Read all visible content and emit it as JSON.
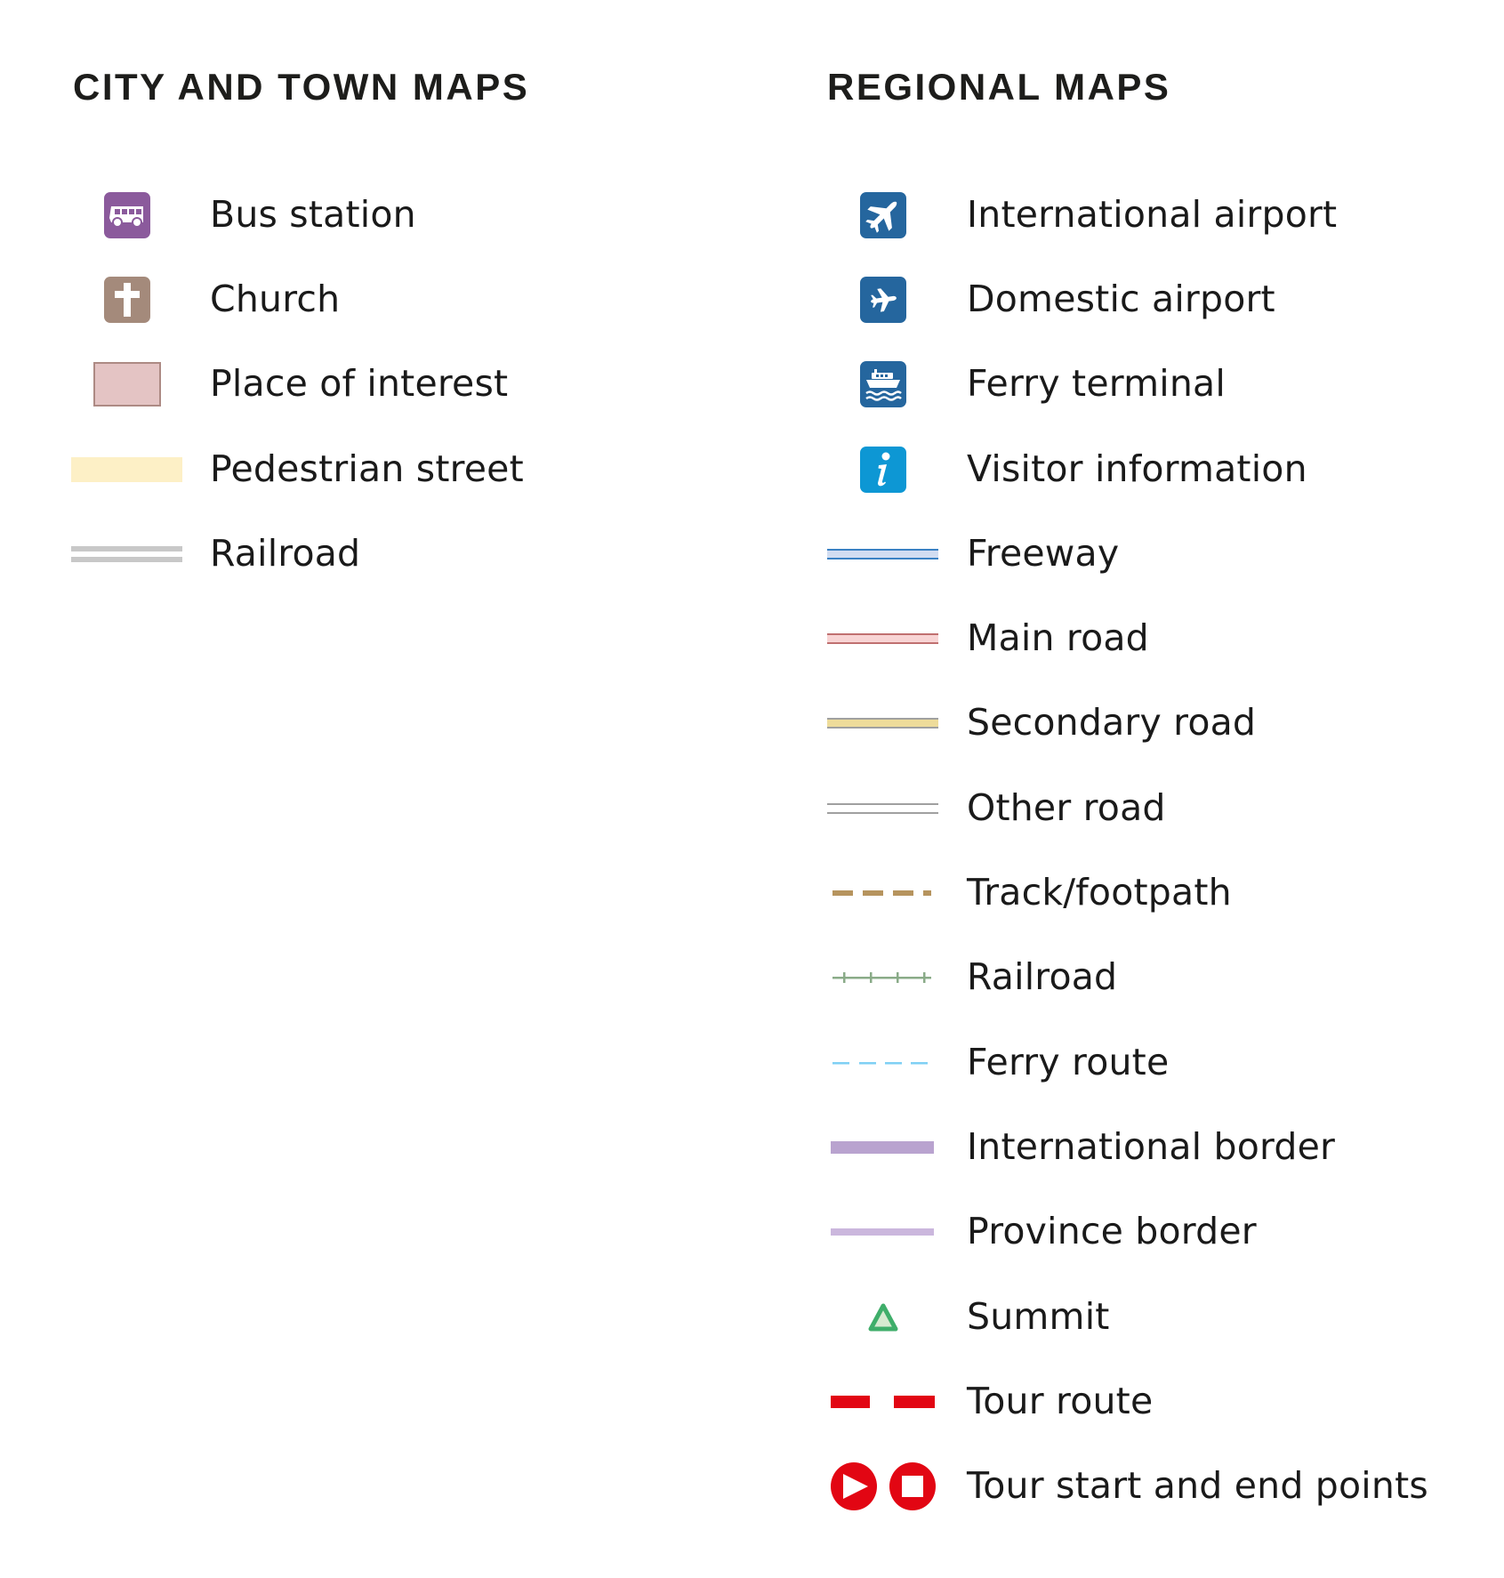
{
  "legend": {
    "city_and_town": {
      "title": "CITY AND TOWN MAPS",
      "items": [
        {
          "label": "Bus station",
          "symbol": "bus-icon",
          "color": "#8b5a9c"
        },
        {
          "label": "Church",
          "symbol": "church-icon",
          "color": "#a48a7b"
        },
        {
          "label": "Place of interest",
          "symbol": "place-of-interest-swatch",
          "color": "#e4c4c4"
        },
        {
          "label": "Pedestrian street",
          "symbol": "pedestrian-street-swatch",
          "color": "#fdf0c6"
        },
        {
          "label": "Railroad",
          "symbol": "railroad-double-line",
          "color": "#c8c8c8"
        }
      ]
    },
    "regional": {
      "title": "REGIONAL MAPS",
      "items": [
        {
          "label": "International airport",
          "symbol": "international-airport-icon",
          "color": "#25669e"
        },
        {
          "label": "Domestic airport",
          "symbol": "domestic-airport-icon",
          "color": "#25669e"
        },
        {
          "label": "Ferry terminal",
          "symbol": "ferry-terminal-icon",
          "color": "#25669e"
        },
        {
          "label": "Visitor information",
          "symbol": "visitor-information-icon",
          "color": "#0d97d4"
        },
        {
          "label": "Freeway",
          "symbol": "freeway-line",
          "color": "#3b82c4"
        },
        {
          "label": "Main road",
          "symbol": "main-road-line",
          "color": "#c07070"
        },
        {
          "label": "Secondary road",
          "symbol": "secondary-road-line",
          "color": "#eedc9a"
        },
        {
          "label": "Other road",
          "symbol": "other-road-line",
          "color": "#a0a0a0"
        },
        {
          "label": "Track/footpath",
          "symbol": "track-footpath-dashed-line",
          "color": "#b6945e"
        },
        {
          "label": "Railroad",
          "symbol": "railroad-ticked-line",
          "color": "#8aab88"
        },
        {
          "label": "Ferry route",
          "symbol": "ferry-route-dashed-line",
          "color": "#7fd0f4"
        },
        {
          "label": "International border",
          "symbol": "international-border-line",
          "color": "#b9a3cf"
        },
        {
          "label": "Province border",
          "symbol": "province-border-line",
          "color": "#cbb7dd"
        },
        {
          "label": "Summit",
          "symbol": "summit-triangle-icon",
          "color": "#3fae6a"
        },
        {
          "label": "Tour route",
          "symbol": "tour-route-dashed-line",
          "color": "#e20613"
        },
        {
          "label": "Tour start and end points",
          "symbol": "tour-start-end-icons",
          "color": "#e20613"
        }
      ]
    }
  }
}
